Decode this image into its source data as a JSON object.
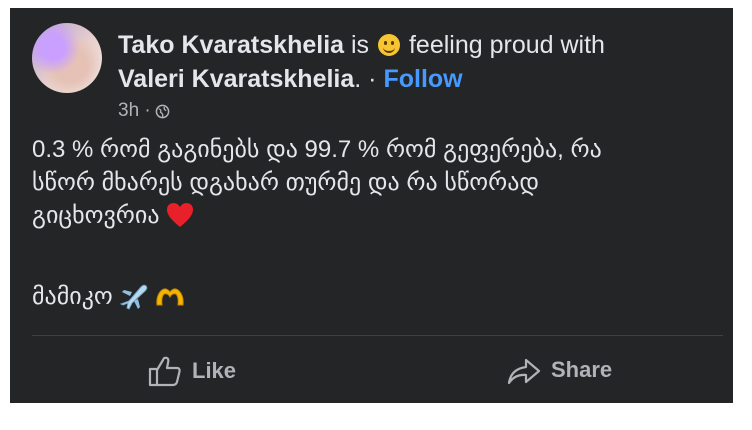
{
  "post": {
    "author_name": "Tako Kvaratskhelia",
    "is_text": "is",
    "feeling_emoji": "smiling-face-emoji",
    "feeling_text": "feeling proud with",
    "tagged_name": "Valeri Kvaratskhelia",
    "tagged_suffix": ". ·",
    "follow_label": "Follow",
    "time": "3h ·",
    "privacy_icon": "globe-icon",
    "body_line1": "0.3 % რომ გაგინებს და 99.7 % რომ გეფერება, რა",
    "body_line2": "სწორ მხარეს დგახარ თურმე და რა სწორად",
    "body_line3": "გიცხოვრია",
    "body_line4": "მამიკო",
    "emojis": [
      "red-heart-emoji",
      "airplane-emoji",
      "heart-hands-emoji"
    ],
    "colors": {
      "background": "#242526",
      "text": "#e4e6eb",
      "muted": "#b0b3b8",
      "link": "#4599ff",
      "heart": "#e8202a"
    }
  },
  "actions": {
    "like_label": "Like",
    "share_label": "Share"
  }
}
